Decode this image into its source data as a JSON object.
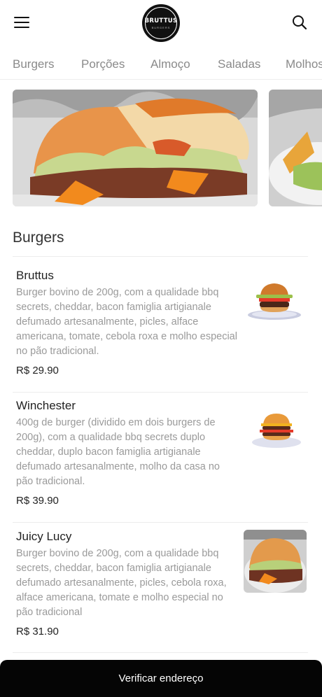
{
  "header": {
    "logo_text": "BRUTTUS",
    "logo_sub": "BURGERS"
  },
  "tabs": [
    {
      "label": "Burgers"
    },
    {
      "label": "Porções"
    },
    {
      "label": "Almoço"
    },
    {
      "label": "Saladas"
    },
    {
      "label": "Molhos"
    }
  ],
  "section": {
    "title": "Burgers"
  },
  "items": [
    {
      "name": "Bruttus",
      "description": "Burger bovino de 200g, com a qualidade bbq secrets, cheddar, bacon famiglia artigianale defumado artesanalmente, picles, alface americana, tomate, cebola roxa e molho especial no pão tradicional.",
      "price": "R$ 29.90"
    },
    {
      "name": "Winchester",
      "description": "400g de burger (dividido em dois burgers de 200g), com a qualidade bbq secrets duplo cheddar, duplo bacon famiglia artigianale defumado artesanalmente, molho da casa no pão tradicional.",
      "price": "R$ 39.90"
    },
    {
      "name": "Juicy Lucy",
      "description": "Burger bovino de 200g, com a qualidade bbq secrets, cheddar, bacon famiglia artigianale defumado artesanalmente, picles, cebola roxa, alface americana, tomate e molho especial no pão tradicional",
      "price": "R$ 31.90"
    }
  ],
  "bottom_bar": {
    "label": "Verificar endereço"
  },
  "colors": {
    "bottom_bar_bg": "#050505",
    "tab_text": "#8a8a8a",
    "description_text": "#9a9a9a"
  },
  "icons": {
    "menu": "hamburger-menu-icon",
    "search": "search-icon"
  }
}
